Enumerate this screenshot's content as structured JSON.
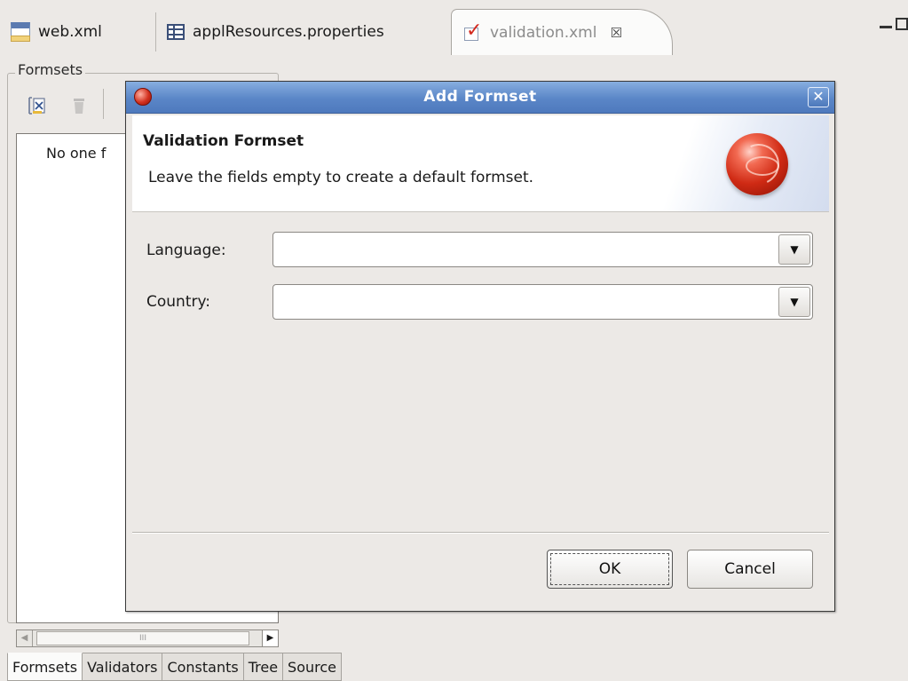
{
  "editor_tabs": [
    {
      "label": "web.xml",
      "icon": "manifest-file-icon"
    },
    {
      "label": "applResources.properties",
      "icon": "table-icon"
    },
    {
      "label": "validation.xml",
      "icon": "checkbox-icon",
      "close": "☒"
    }
  ],
  "formsets_panel": {
    "group_title": "Formsets",
    "empty_text": "No one f"
  },
  "bottom_tabs": [
    "Formsets",
    "Validators",
    "Constants",
    "Tree",
    "Source"
  ],
  "dialog": {
    "title": "Add Formset",
    "close_glyph": "✕",
    "banner_title": "Validation Formset",
    "banner_description": "Leave the fields empty to create a default formset.",
    "language_label": "Language:",
    "language_value": "",
    "country_label": "Country:",
    "country_value": "",
    "ok_label": "OK",
    "cancel_label": "Cancel"
  },
  "scrollbar": {
    "thumb_grip": "III"
  },
  "colors": {
    "titlebar": "#5a86c7",
    "accent_red": "#cf2a14"
  }
}
